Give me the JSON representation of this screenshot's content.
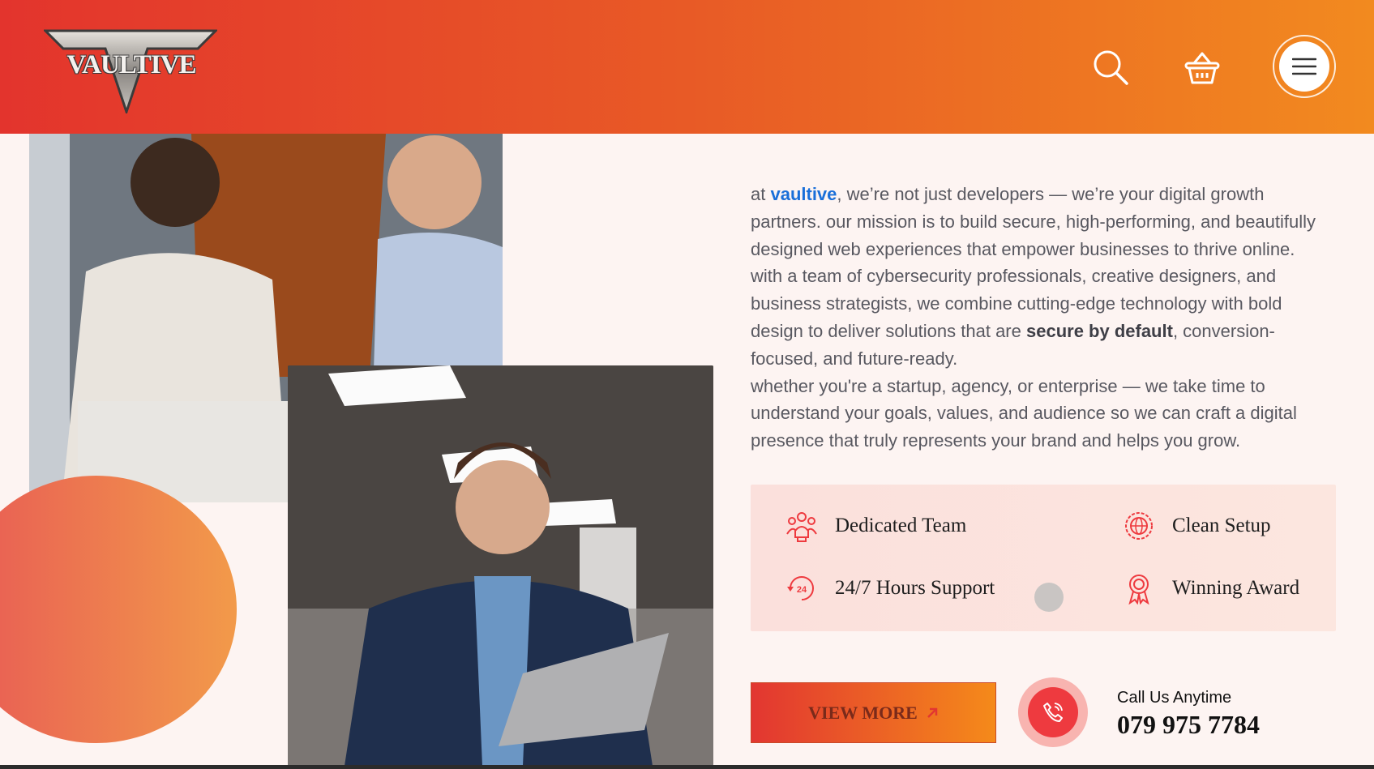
{
  "brand": {
    "logo_text": "VAULTIVE"
  },
  "header": {
    "icons": [
      "search-icon",
      "basket-icon",
      "menu-icon"
    ],
    "gradient": [
      "#e3342d",
      "#f28a1f"
    ]
  },
  "about": {
    "intro_prefix": "at ",
    "brand_name": "vaultive",
    "intro_rest": ", we’re not just developers — we’re your digital growth partners. our mission is to build secure, high-performing, and beautifully designed web experiences that empower businesses to thrive online. with a team of cybersecurity professionals, creative designers, and business strategists, we combine cutting-edge technology with bold design to deliver solutions that are ",
    "emphasis": "secure by default",
    "intro_end": ", conversion-focused, and future-ready.",
    "paragraph2": "whether you're a startup, agency, or enterprise — we take time to understand your goals, values, and audience so we can craft a digital presence that truly represents your brand and helps you grow."
  },
  "features": [
    {
      "label": "Dedicated Team",
      "icon": "team-icon"
    },
    {
      "label": "Clean Setup",
      "icon": "globe-gear-icon"
    },
    {
      "label": "24/7 Hours Support",
      "icon": "support-24-icon"
    },
    {
      "label": "Winning Award",
      "icon": "award-icon"
    }
  ],
  "cta": {
    "view_more": "VIEW MORE",
    "call_label": "Call Us Anytime",
    "phone": "079 975 7784"
  },
  "colors": {
    "accent": "#ee3a3f",
    "link": "#1a6fd9",
    "orange": "#f58a1a"
  }
}
